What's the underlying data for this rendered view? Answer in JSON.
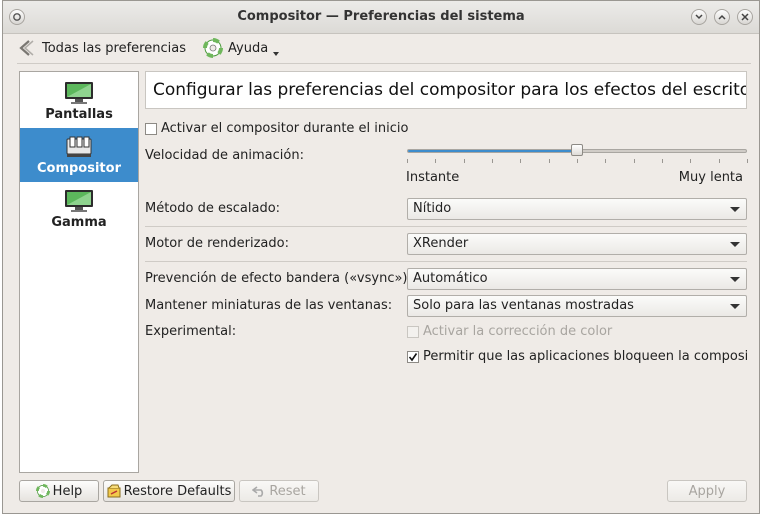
{
  "window": {
    "title_main": "Compositor",
    "title_sep": " — ",
    "title_rest": "Preferencias del sistema"
  },
  "toolbar": {
    "back_label": "Todas las preferencias",
    "help_label": "Ayuda"
  },
  "sidebar": {
    "items": [
      {
        "label": "Pantallas",
        "selected": false
      },
      {
        "label": "Compositor",
        "selected": true
      },
      {
        "label": "Gamma",
        "selected": false
      }
    ]
  },
  "main": {
    "heading": "Configurar las preferencias del compositor para los efectos del escritorio",
    "enable_on_start": {
      "label": "Activar el compositor durante el inicio",
      "checked": false
    },
    "animation_speed": {
      "label": "Velocidad de animación:",
      "min_label": "Instante",
      "max_label": "Muy lenta",
      "value_fraction": 0.5
    },
    "scaling": {
      "label": "Método de escalado:",
      "value": "Nítido"
    },
    "render": {
      "label": "Motor de renderizado:",
      "value": "XRender"
    },
    "tearing": {
      "label": "Prevención de efecto bandera («vsync»):",
      "value": "Automático"
    },
    "thumbnails": {
      "label": "Mantener miniaturas de las ventanas:",
      "value": "Solo para las ventanas mostradas"
    },
    "experimental": {
      "label": "Experimental:",
      "color_correction": {
        "label": "Activar la corrección de color",
        "checked": false,
        "enabled": false
      },
      "allow_block": {
        "label": "Permitir que las aplicaciones bloqueen la composición",
        "checked": true
      }
    }
  },
  "buttons": {
    "help": "Help",
    "restore": "Restore Defaults",
    "reset": "Reset",
    "apply": "Apply"
  },
  "colors": {
    "accent": "#3d8ccc",
    "window_bg": "#efebe7"
  }
}
